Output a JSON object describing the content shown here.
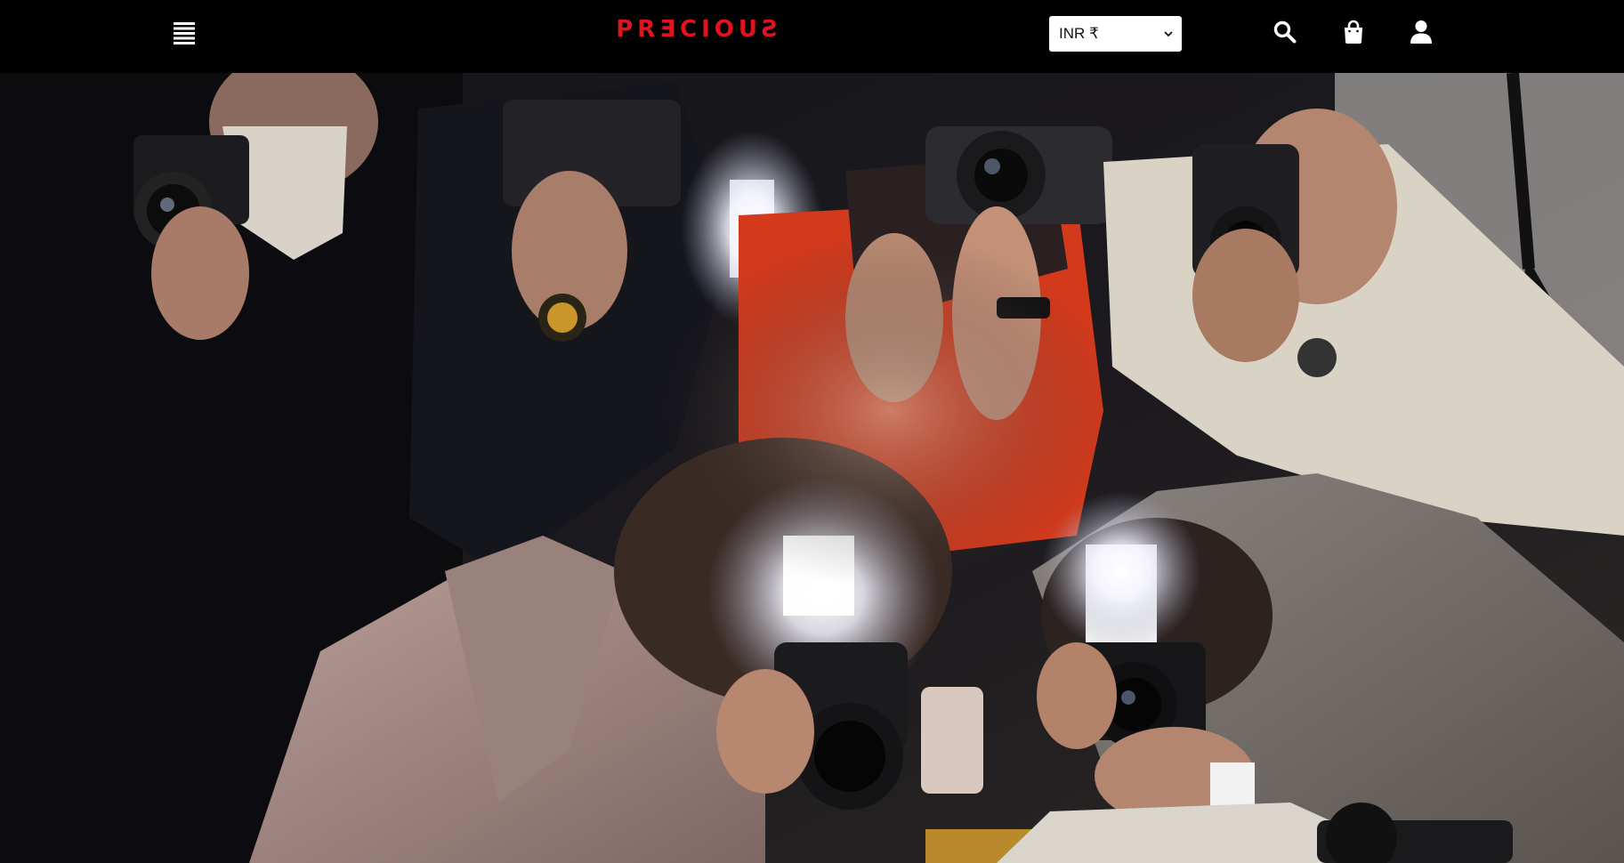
{
  "header": {
    "brand": "PRƎCIOUƧ",
    "currency": {
      "selected": "INR ₹"
    },
    "icons": {
      "menu": "menu-icon",
      "search": "search-icon",
      "cart": "shopping-bag-icon",
      "account": "user-icon",
      "dropdown": "chevron-down-icon"
    },
    "colors": {
      "background": "#000000",
      "brand": "#e0141e",
      "icon": "#ffffff"
    }
  },
  "hero": {
    "image": "photographers-with-cameras-and-flash"
  }
}
